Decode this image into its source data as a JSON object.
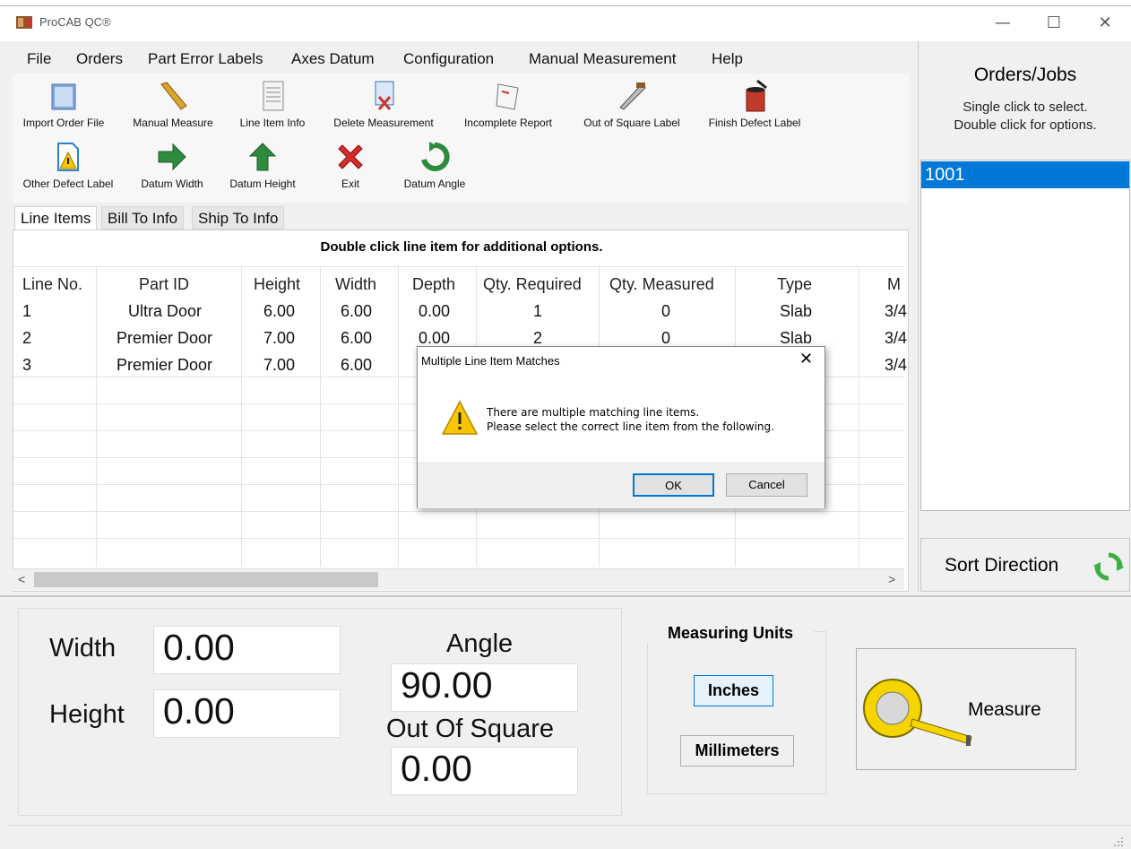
{
  "window": {
    "title": "ProCAB QC®",
    "minimize": "—",
    "maximize": "☐",
    "close": "✕"
  },
  "menu": [
    "File",
    "Orders",
    "Part Error Labels",
    "Axes Datum",
    "Configuration",
    "Manual Measurement",
    "Help"
  ],
  "toolbar": {
    "row1": [
      "Import Order File",
      "Manual Measure",
      "Line Item Info",
      "Delete Measurement",
      "Incomplete Report",
      "Out of Square Label",
      "Finish Defect Label"
    ],
    "row2": [
      "Other Defect Label",
      "Datum Width",
      "Datum Height",
      "Exit",
      "Datum Angle"
    ]
  },
  "tabs": [
    "Line Items",
    "Bill To Info",
    "Ship To Info"
  ],
  "grid": {
    "hint": "Double click line item for additional options.",
    "columns": [
      "Line No.",
      "Part ID",
      "Height",
      "Width",
      "Depth",
      "Qty. Required",
      "Qty. Measured",
      "Type",
      "M"
    ],
    "rows": [
      [
        "1",
        "Ultra Door",
        "6.00",
        "6.00",
        "0.00",
        "1",
        "0",
        "Slab",
        "3/4"
      ],
      [
        "2",
        "Premier Door",
        "7.00",
        "6.00",
        "0.00",
        "2",
        "0",
        "Slab",
        "3/4"
      ],
      [
        "3",
        "Premier Door",
        "7.00",
        "6.00",
        "",
        "",
        "",
        "",
        "3/4"
      ]
    ],
    "scroll_left": "<",
    "scroll_right": ">"
  },
  "orders": {
    "title": "Orders/Jobs",
    "sub1": "Single click to select.",
    "sub2": "Double click for options.",
    "items": [
      "1001"
    ],
    "sort_label": "Sort Direction"
  },
  "measure": {
    "width_label": "Width",
    "width_value": "0.00",
    "height_label": "Height",
    "height_value": "0.00",
    "angle_label": "Angle",
    "angle_value": "90.00",
    "oos_label": "Out Of Square",
    "oos_value": "0.00",
    "units_title": "Measuring Units",
    "inches": "Inches",
    "millimeters": "Millimeters",
    "measure_button": "Measure"
  },
  "dialog": {
    "title": "Multiple Line Item Matches",
    "close": "✕",
    "line1": "There are multiple matching line items.",
    "line2": "Please select the correct line item from the following.",
    "ok": "OK",
    "cancel": "Cancel"
  },
  "colors": {
    "selection": "#0078d7",
    "accent_button_bg": "#e5f1fb",
    "warning": "#f7c600"
  }
}
